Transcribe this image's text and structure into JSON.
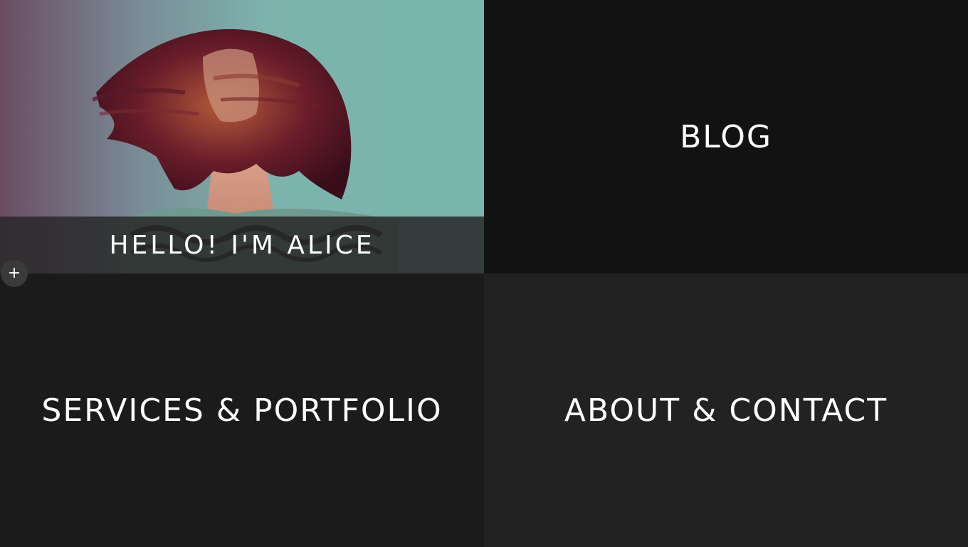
{
  "tiles": {
    "hero": {
      "label": "HELLO! I'M ALICE"
    },
    "blog": {
      "label": "BLOG"
    },
    "services": {
      "label": "SERVICES & PORTFOLIO"
    },
    "about": {
      "label": "ABOUT & CONTACT"
    }
  },
  "add_button": {
    "icon": "plus-icon",
    "glyph": "+"
  },
  "colors": {
    "hero_bg": "#78b6ad",
    "blog_bg": "#121212",
    "services_bg": "#1b1b1b",
    "about_bg": "#222222",
    "text": "#ffffff"
  }
}
